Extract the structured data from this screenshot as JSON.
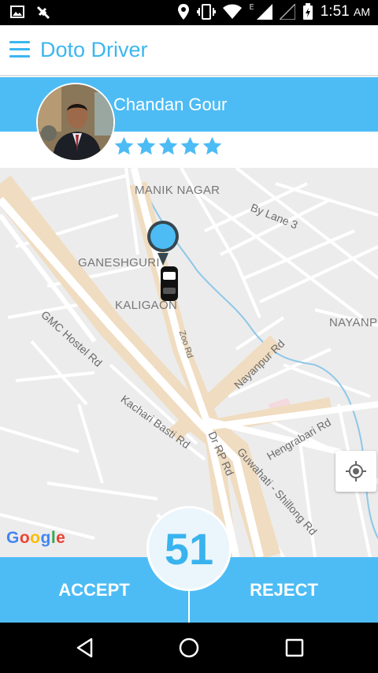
{
  "status_bar": {
    "time": "1:51",
    "ampm": "AM",
    "network_letter": "E",
    "icons": [
      "image-icon",
      "location-icon",
      "vibrate-icon",
      "wifi-icon",
      "signal-icon",
      "battery-icon"
    ]
  },
  "app_bar": {
    "title": "Doto Driver",
    "menu_icon": "hamburger-menu-icon"
  },
  "driver": {
    "name": "Chandan Gour",
    "rating": 5,
    "max_rating": 5
  },
  "map": {
    "labels": {
      "manik_nagar": "MANIK NAGAR",
      "by_lane": "By Lane 3",
      "ganeshguri": "GANESHGURI",
      "kaligaon": "KALIGAON",
      "nayanpur_area": "NAYANP",
      "gmc_hostel": "GMC Hostel Rd",
      "zoo_rd": "Zoo Rd",
      "nayanpur_rd": "Nayanpur Rd",
      "kachari": "Kachari Basti Rd",
      "dr_rp": "Dr RP Rd",
      "guwahati": "Guwahati - Shillong Rd",
      "hengrabari": "Hengrabari Rd"
    },
    "google_logo": [
      "G",
      "o",
      "o",
      "g",
      "l",
      "e"
    ]
  },
  "colors": {
    "accent": "#4dbcf5",
    "title": "#3bb6f0",
    "star": "#4dbcf5"
  },
  "actions": {
    "accept": "ACCEPT",
    "reject": "REJECT",
    "countdown": "51"
  }
}
